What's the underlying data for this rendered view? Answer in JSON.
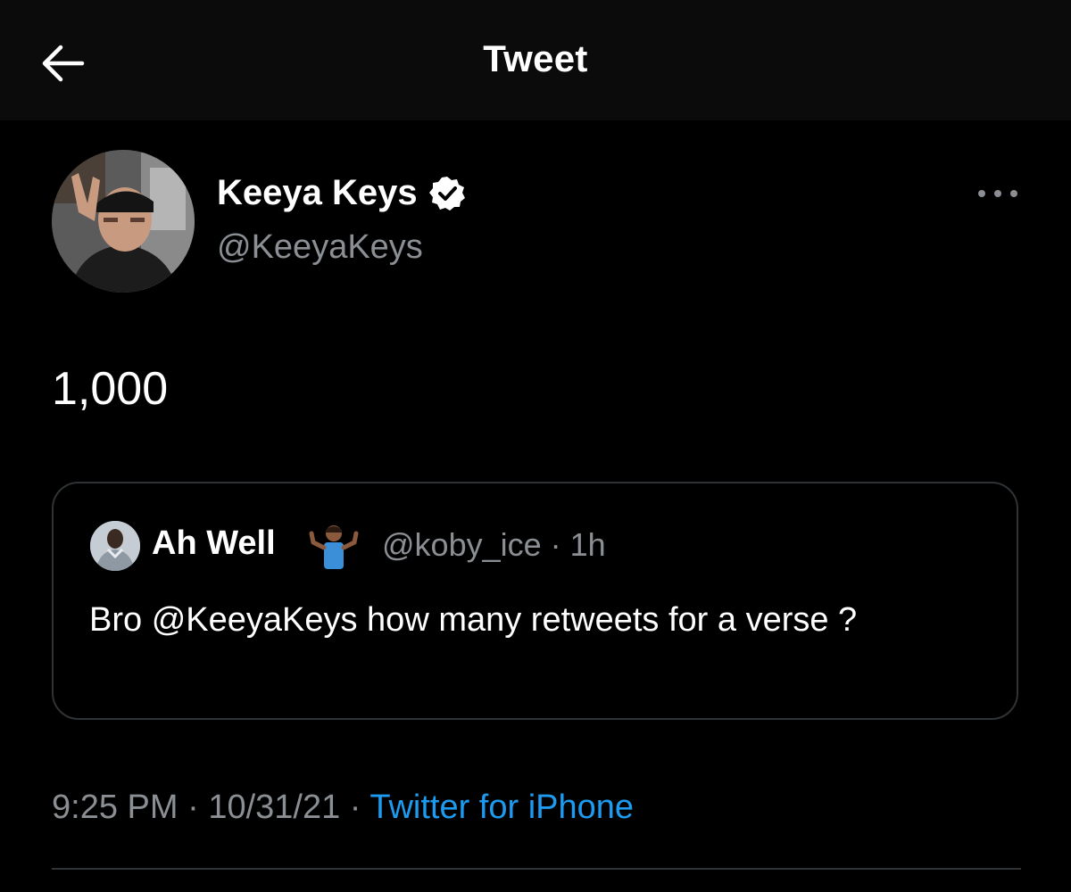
{
  "header": {
    "title": "Tweet",
    "back_icon": "arrow-left-icon"
  },
  "tweet": {
    "author": {
      "display_name": "Keeya Keys",
      "handle": "@KeeyaKeys",
      "verified": true,
      "verified_icon": "verified-badge-icon"
    },
    "more_icon": "more-options-icon",
    "text": "1,000",
    "timestamp_time": "9:25 PM",
    "separator_1": " · ",
    "timestamp_date": "10/31/21",
    "separator_2": " · ",
    "source": "Twitter for iPhone"
  },
  "quoted_tweet": {
    "display_name": "Ah Well",
    "emoji": "shrug-emoji",
    "handle": "@koby_ice",
    "separator": " · ",
    "time_ago": "1h",
    "text": "Bro @KeeyaKeys how many retweets for a verse ?"
  },
  "colors": {
    "background": "#000000",
    "header_bg": "#0b0b0b",
    "text_primary": "#ffffff",
    "text_secondary": "#8b8f94",
    "link": "#1d9bf0",
    "border": "#2f3336"
  }
}
